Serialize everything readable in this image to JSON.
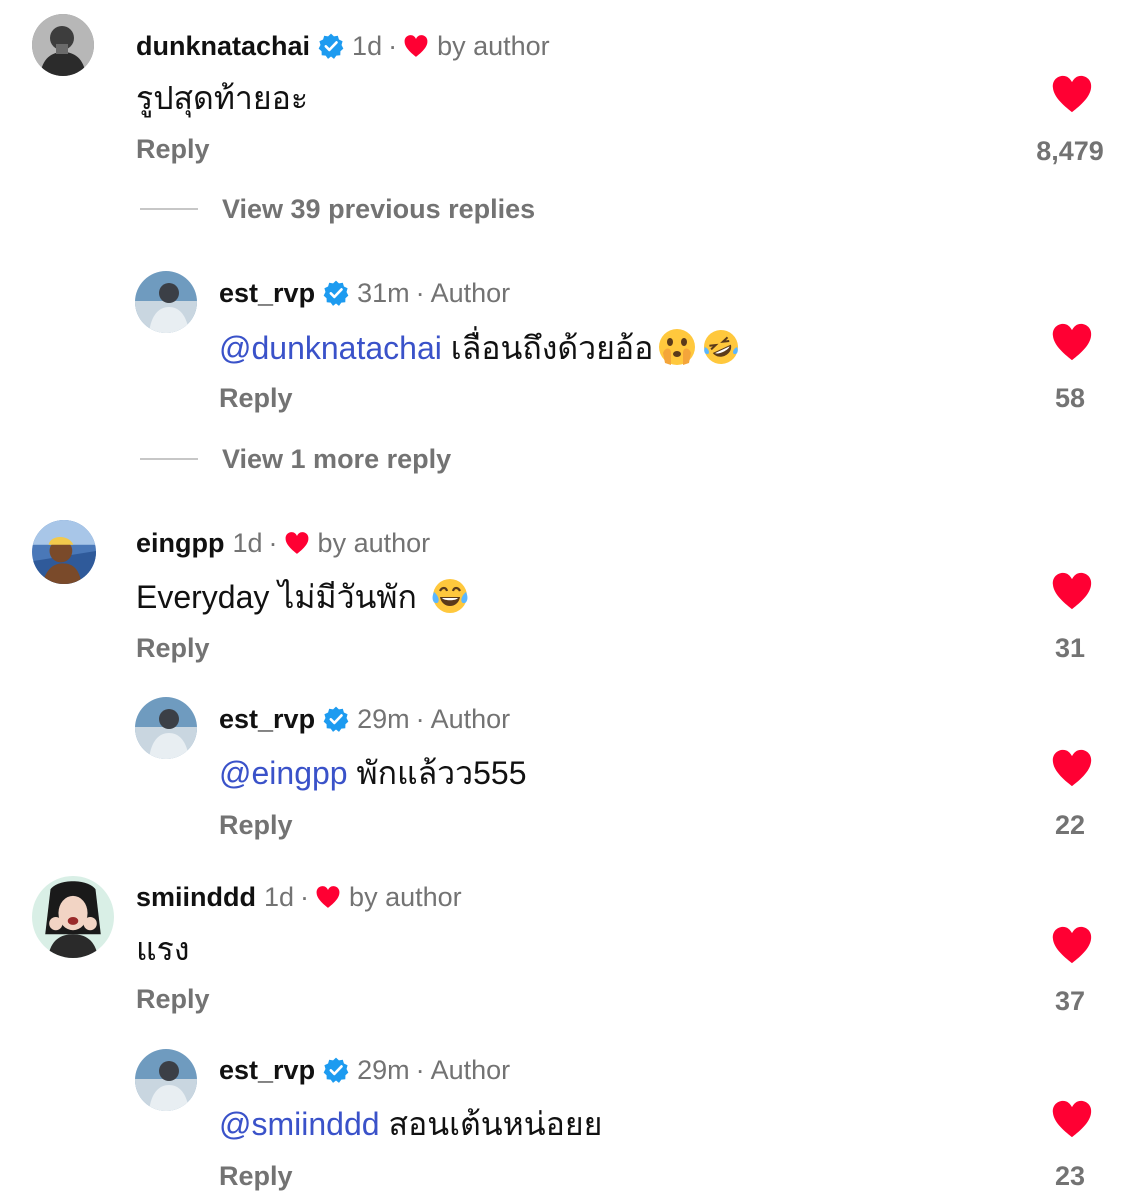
{
  "comments": [
    {
      "username": "dunknatachai",
      "verified": true,
      "time": "1d",
      "liked_by_author": true,
      "liked_label": "by author",
      "text": "รูปสุดท้ายอะ",
      "reply_label": "Reply",
      "like_count": "8,479",
      "view_replies_label": "View 39 previous replies",
      "reply": {
        "username": "est_rvp",
        "verified": true,
        "time": "31m",
        "role": "Author",
        "mention": "@dunknatachai",
        "text": "เลื่อนถึงด้วยอ้อ",
        "emojis": [
          "face-with-open-eyes-and-hand-over-mouth",
          "rolling-on-the-floor-laughing"
        ],
        "reply_label": "Reply",
        "like_count": "58"
      },
      "more_replies_label": "View 1 more reply"
    },
    {
      "username": "eingpp",
      "verified": false,
      "time": "1d",
      "liked_by_author": true,
      "liked_label": "by author",
      "text": "Everyday ไม่มีวันพัก",
      "emojis": [
        "face-with-tears-of-joy"
      ],
      "reply_label": "Reply",
      "like_count": "31",
      "reply": {
        "username": "est_rvp",
        "verified": true,
        "time": "29m",
        "role": "Author",
        "mention": "@eingpp",
        "text": "พักแล้วว555",
        "reply_label": "Reply",
        "like_count": "22"
      }
    },
    {
      "username": "smiinddd",
      "verified": false,
      "time": "1d",
      "liked_by_author": true,
      "liked_label": "by author",
      "text": "แรง",
      "reply_label": "Reply",
      "like_count": "37",
      "reply": {
        "username": "est_rvp",
        "verified": true,
        "time": "29m",
        "role": "Author",
        "mention": "@smiinddd",
        "text": "สอนเต้นหน่อยย",
        "reply_label": "Reply",
        "like_count": "23"
      }
    }
  ],
  "colors": {
    "heart": "#ff0033",
    "verified": "#1d9bf0",
    "mention": "#3a52c9",
    "secondary_text": "#737373"
  },
  "separator": "·"
}
